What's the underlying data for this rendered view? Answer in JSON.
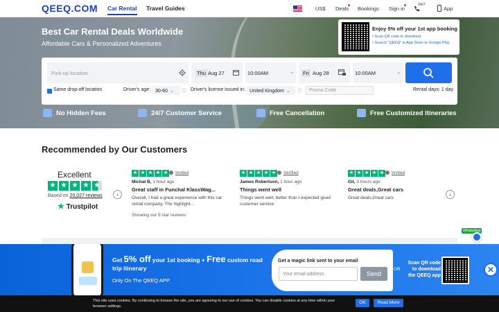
{
  "header": {
    "logo": "QEEQ.COM",
    "nav": [
      "Car Rental",
      "Travel Guides"
    ],
    "currency": "US$",
    "deals": "Deals",
    "bookings": "Bookings",
    "sign_in": "Sign in",
    "support": "24/7",
    "app": "App"
  },
  "hero": {
    "title": "Best Car Rental Deals Worldwide",
    "subtitle": "Affordable Cars & Personalized Adventures",
    "promo": {
      "title": "Enjoy 5% off your 1st app booking",
      "line1": "• Scan QR code to download",
      "line2": "• Search \"QEEQ\" in App Store or Google Play"
    }
  },
  "search": {
    "pickup_placeholder": "Pick-up location",
    "pickup_day": "Thu",
    "pickup_date": "Aug 27",
    "pickup_time": "10:00AM",
    "dropoff_day": "Fri",
    "dropoff_date": "Aug 28",
    "dropoff_time": "10:00AM",
    "same_dropoff": "Same drop-off location",
    "age_label": "Driver's age:",
    "age_value": "30-60",
    "license_label": "Driver's license issued in:",
    "license_value": "United Kingdom",
    "promo_placeholder": "Promo Code",
    "rental_days": "Rental days: 1 day"
  },
  "features": [
    "No Hidden Fees",
    "24/7 Customer Service",
    "Free Cancellation",
    "Free Customized Itineraries"
  ],
  "recommend": {
    "title": "Recommended by Our Customers",
    "rating_word": "Excellent",
    "based_prefix": "Based on",
    "based_count": "20,027 reviews",
    "brand": "Trustpilot",
    "showing": "Showing our 5 star reviews",
    "reviews": [
      {
        "tag": "Invited",
        "author": "Michał B,",
        "time": "1 hour ago",
        "title": "Great staff in Funchal KlassWag...",
        "body": "Overall, I had a great experience with this car rental company. The highlight..."
      },
      {
        "tag": "Verified",
        "author": "James Robertson,",
        "time": "1 hour ago",
        "title": "Things went well",
        "body": "Things went well, better than I expected good customer service"
      },
      {
        "tag": "Invited",
        "author": "Gil,",
        "time": "3 hours ago",
        "title": "Great deals,Great cars",
        "body": "Great deals,Great cars"
      }
    ]
  },
  "whatsapp": "WhatsApp",
  "app_banner": {
    "get": "Get",
    "pct": "5% off",
    "line_mid": "your 1st booking +",
    "free": "Free",
    "line_end": "custom road trip itinerary",
    "only": "Only On The QEEQ APP",
    "magic_title": "Get a magic link sent to your email",
    "email_placeholder": "Your email address",
    "send": "Send",
    "or": "OR",
    "qr_text": "Scan QR code to download the QEEQ app"
  },
  "cookie": {
    "text": "This site uses cookies. By continuing to browse the site, you are agreeing to our use of cookies. You can disable cookies at any time within your browser settings.",
    "ok": "OK",
    "more": "Read More"
  }
}
